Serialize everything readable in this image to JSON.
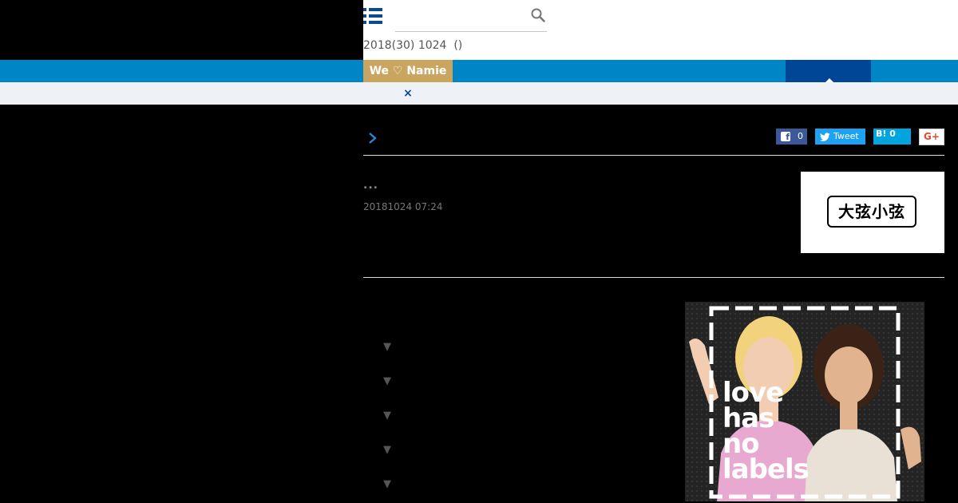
{
  "header": {
    "search": {
      "placeholder": "",
      "value": ""
    },
    "date_line": "2018(30) 1024  ()"
  },
  "nav": {
    "badge_label": "We ♡ Namie"
  },
  "notice": {
    "close_label": "×"
  },
  "share": {
    "facebook_count": "0",
    "tweet_label": "Tweet",
    "hatena_label": "B! 0",
    "gplus_label": "G+"
  },
  "post": {
    "title": "...",
    "datetime": "20181024 07:24",
    "logo_text": "大弦小弦"
  },
  "toc": {
    "items": [
      "▼",
      "▼",
      "▼",
      "▼",
      "▼"
    ]
  },
  "ad": {
    "lines": [
      "love",
      "has",
      "no",
      "labels"
    ]
  },
  "colors": {
    "nav_blue": "#0085c7",
    "nav_active": "#004696",
    "badge_gold": "#c9a560",
    "notice_bg": "#eef1f5",
    "facebook": "#3b5998",
    "twitter": "#1da1f2",
    "hatena": "#00a4de"
  },
  "icons": {
    "menu": "list-menu-icon",
    "search": "search-icon",
    "breadcrumb": "chevron-right-icon",
    "facebook": "facebook-icon",
    "twitter": "twitter-bird-icon"
  }
}
